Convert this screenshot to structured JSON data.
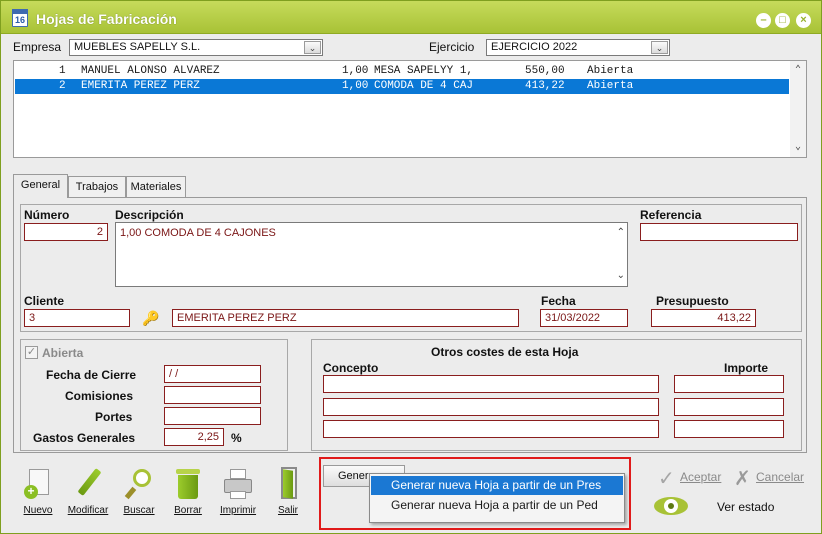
{
  "window": {
    "title": "Hojas de Fabricación",
    "icon_text": "16"
  },
  "empresa": {
    "label": "Empresa",
    "value": "MUEBLES SAPELLY S.L."
  },
  "ejercicio": {
    "label": "Ejercicio",
    "value": "EJERCICIO 2022"
  },
  "list": {
    "rows": [
      {
        "num": "1",
        "name": "MANUEL ALONSO ALVAREZ",
        "qty": "1,00",
        "desc": "MESA SAPELYY 1,",
        "amount": "550,00",
        "state": "Abierta"
      },
      {
        "num": "2",
        "name": "EMERITA PEREZ PERZ",
        "qty": "1,00",
        "desc": "COMODA DE 4 CAJ",
        "amount": "413,22",
        "state": "Abierta"
      }
    ]
  },
  "tabs": [
    "General",
    "Trabajos",
    "Materiales"
  ],
  "general": {
    "numero_label": "Número",
    "numero": "2",
    "descripcion_label": "Descripción",
    "descripcion": "1,00 COMODA DE 4 CAJONES",
    "referencia_label": "Referencia",
    "referencia": "",
    "cliente_label": "Cliente",
    "cliente_code": "3",
    "cliente_name": "EMERITA PEREZ PERZ",
    "fecha_label": "Fecha",
    "fecha": "31/03/2022",
    "presupuesto_label": "Presupuesto",
    "presupuesto": "413,22"
  },
  "estado": {
    "abierta_label": "Abierta",
    "fecha_cierre_label": "Fecha de Cierre",
    "fecha_cierre": "/ /",
    "comisiones_label": "Comisiones",
    "comisiones": "",
    "portes_label": "Portes",
    "portes": "",
    "gastos_label": "Gastos Generales",
    "gastos": "2,25",
    "gastos_unit": "%"
  },
  "otros": {
    "title": "Otros costes de esta Hoja",
    "concepto_label": "Concepto",
    "importe_label": "Importe"
  },
  "toolbar": {
    "nuevo": "Nuevo",
    "modificar": "Modificar",
    "buscar": "Buscar",
    "borrar": "Borrar",
    "imprimir": "Imprimir",
    "salir": "Salir"
  },
  "generar": {
    "button": "Gener",
    "items": [
      "Generar nueva Hoja a partir de un Pres",
      "Generar nueva Hoja a partir de un  Ped"
    ]
  },
  "actions": {
    "aceptar": "Aceptar",
    "cancelar": "Cancelar",
    "ver_estado": "Ver estado"
  },
  "colors": {
    "accent": "#a8c236",
    "selection": "#0a78d6",
    "field_border": "#8a1e1e",
    "highlight_box": "#e01a1a"
  }
}
